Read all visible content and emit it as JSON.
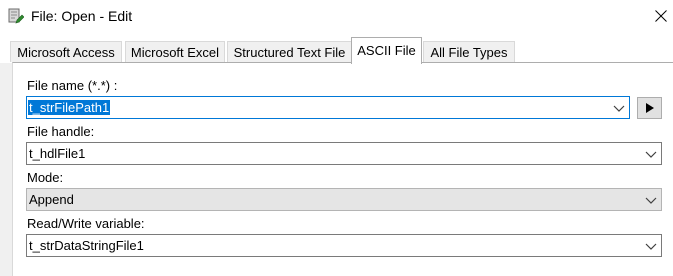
{
  "window": {
    "title": "File: Open - Edit",
    "close_symbol": "close-icon",
    "app_icon": "document-pencil-icon"
  },
  "tabs": [
    {
      "label": "Microsoft Access",
      "active": false
    },
    {
      "label": "Microsoft Excel",
      "active": false
    },
    {
      "label": "Structured Text File",
      "active": false
    },
    {
      "label": "ASCII File",
      "active": true
    },
    {
      "label": "All File Types",
      "active": false
    }
  ],
  "form": {
    "file_name": {
      "label": "File name (*.*) :",
      "value": "t_strFilePath1",
      "selected": true,
      "focused": true
    },
    "file_handle": {
      "label": "File handle:",
      "value": "t_hdlFile1"
    },
    "mode": {
      "label": "Mode:",
      "value": "Append"
    },
    "rw_variable": {
      "label": "Read/Write variable:",
      "value": "t_strDataStringFile1"
    }
  },
  "icons": {
    "run": "play-triangle-icon",
    "dropdown": "chevron-down-icon"
  },
  "colors": {
    "selection": "#0078d7",
    "focus_border": "#0078d7",
    "dialog_bg": "#f0f0f0",
    "panel_bg": "#ffffff"
  }
}
